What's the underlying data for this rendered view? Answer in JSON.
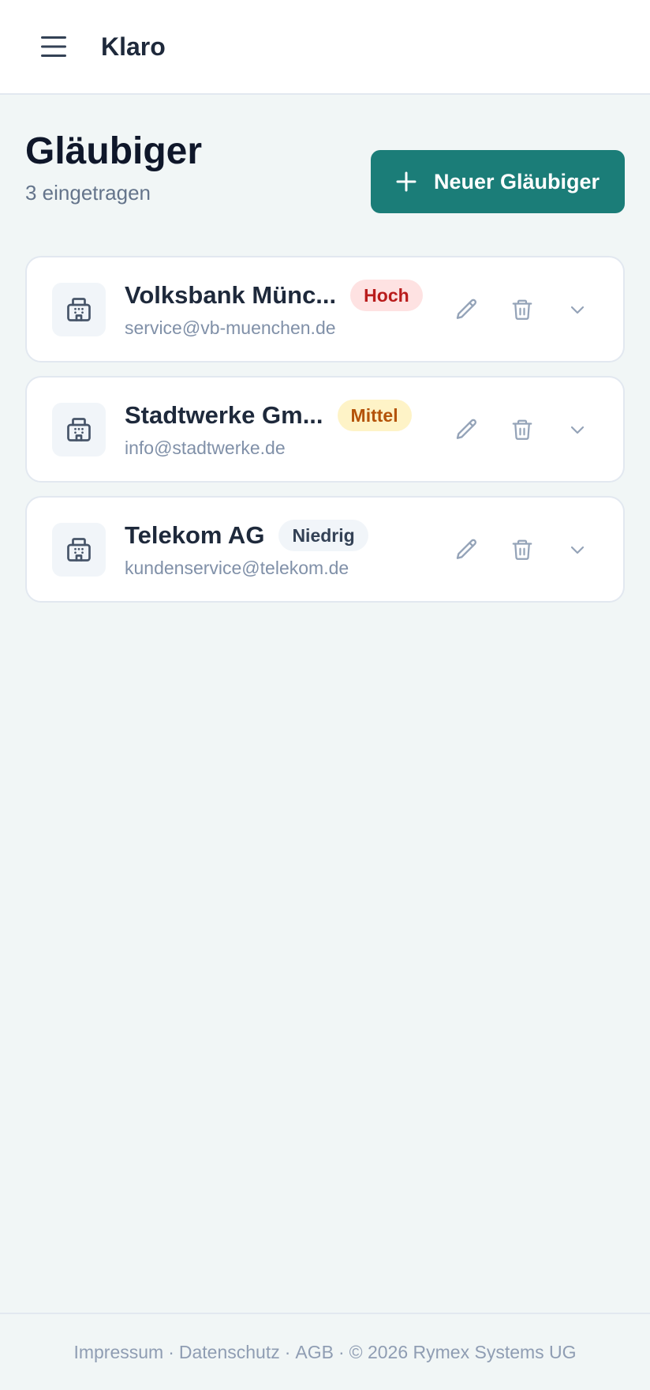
{
  "app": {
    "title": "Klaro"
  },
  "page": {
    "title": "Gläubiger",
    "subtitle": "3 eingetragen",
    "new_button_label": "Neuer Gläubiger"
  },
  "creditors": [
    {
      "name": "Volksbank Münc...",
      "email": "service@vb-muenchen.de",
      "priority": "Hoch",
      "priority_level": "high"
    },
    {
      "name": "Stadtwerke Gm...",
      "email": "info@stadtwerke.de",
      "priority": "Mittel",
      "priority_level": "mid"
    },
    {
      "name": "Telekom AG",
      "email": "kundenservice@telekom.de",
      "priority": "Niedrig",
      "priority_level": "low"
    }
  ],
  "footer": {
    "impressum": "Impressum",
    "datenschutz": "Datenschutz",
    "agb": "AGB",
    "copyright": "© 2026 Rymex Systems UG",
    "separator": "·"
  },
  "colors": {
    "primary": "#1b7d78",
    "background": "#f1f6f6",
    "badge_high_bg": "#fee2e2",
    "badge_high_text": "#b91c1c",
    "badge_mid_bg": "#fef3c7",
    "badge_mid_text": "#b45309",
    "badge_low_bg": "#f1f5f9",
    "badge_low_text": "#334155"
  },
  "icons": {
    "menu": "hamburger-menu-icon",
    "add": "plus-icon",
    "creditor": "building-icon",
    "edit": "pencil-icon",
    "delete": "trash-icon",
    "expand": "chevron-down-icon"
  }
}
